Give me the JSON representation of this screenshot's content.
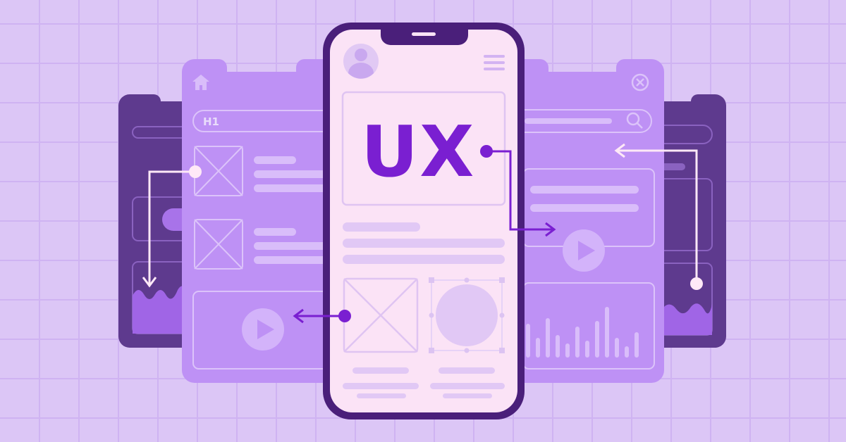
{
  "hero": {
    "title": "UX",
    "heading_tag": "H1"
  },
  "icons": {
    "home": "home-icon",
    "close": "close-icon",
    "search": "search-icon",
    "menu": "hamburger-menu-icon",
    "avatar": "user-avatar-icon",
    "play": "play-icon",
    "image_placeholder": "image-placeholder-icon"
  },
  "colors": {
    "background": "#dcc6f6",
    "grid": "#cfb3f2",
    "panel_light": "#be91f5",
    "panel_dark": "#5e3a8e",
    "phone_frame": "#4a1f7a",
    "phone_screen": "#fbe3f6",
    "accent": "#7a1fd1",
    "connector_light": "#ffe9f7"
  },
  "bar_levels": [
    0.6,
    0.35,
    0.7,
    0.4,
    0.25,
    0.55,
    0.3,
    0.65,
    0.9,
    0.35,
    0.2,
    0.45
  ]
}
